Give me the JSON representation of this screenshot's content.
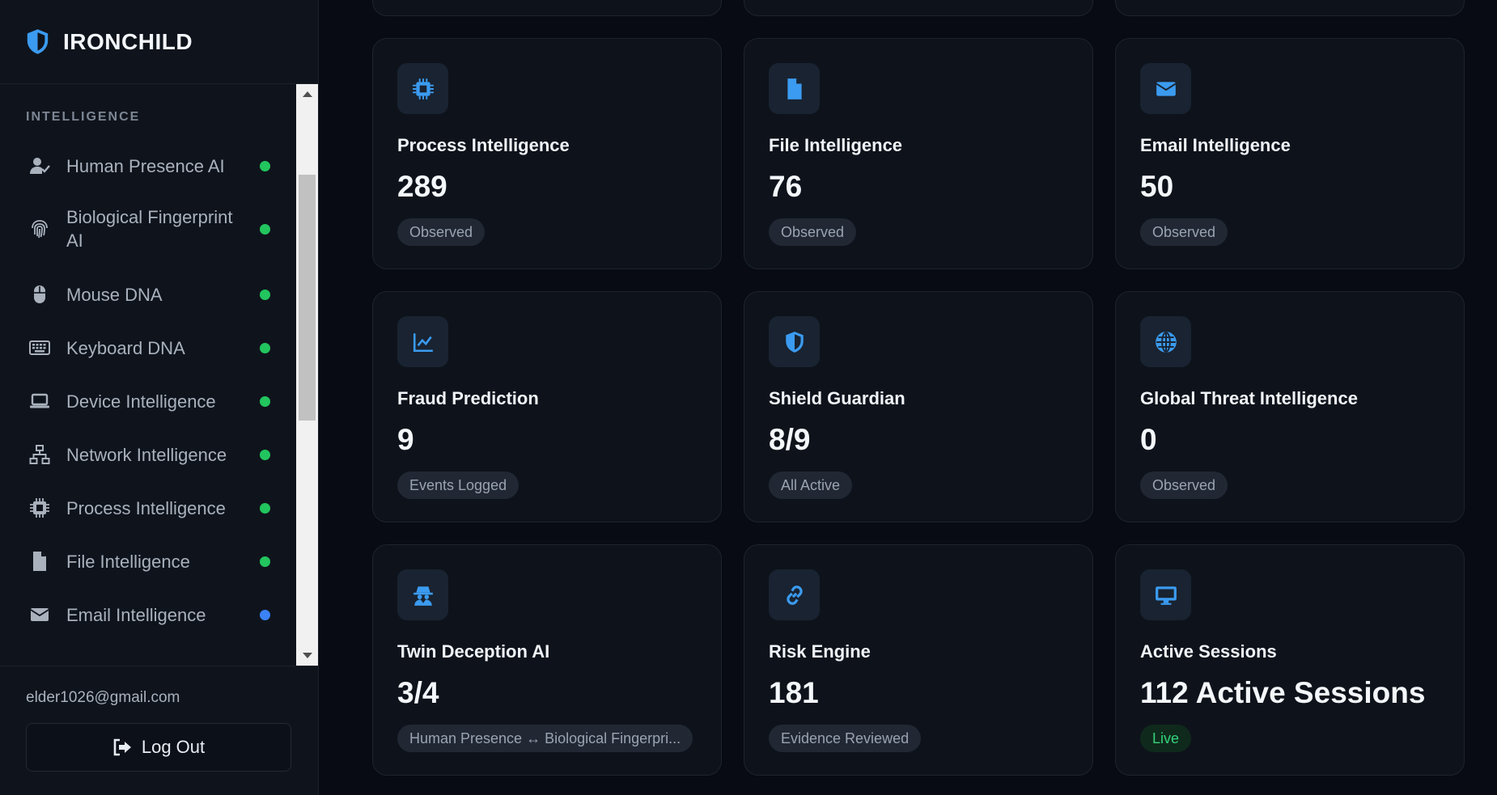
{
  "brand": {
    "name": "IRONCHILD",
    "icon": "shield-icon"
  },
  "sidebar": {
    "section_title": "INTELLIGENCE",
    "items": [
      {
        "label": "Human Presence AI",
        "icon": "user-check-icon",
        "status": "green"
      },
      {
        "label": "Biological Fingerprint AI",
        "icon": "fingerprint-icon",
        "status": "green"
      },
      {
        "label": "Mouse DNA",
        "icon": "mouse-icon",
        "status": "green"
      },
      {
        "label": "Keyboard DNA",
        "icon": "keyboard-icon",
        "status": "green"
      },
      {
        "label": "Device Intelligence",
        "icon": "laptop-icon",
        "status": "green"
      },
      {
        "label": "Network Intelligence",
        "icon": "network-icon",
        "status": "green"
      },
      {
        "label": "Process Intelligence",
        "icon": "cpu-icon",
        "status": "green"
      },
      {
        "label": "File Intelligence",
        "icon": "file-icon",
        "status": "green"
      },
      {
        "label": "Email Intelligence",
        "icon": "envelope-icon",
        "status": "blue"
      }
    ],
    "user_email": "elder1026@gmail.com",
    "logout_label": "Log Out"
  },
  "cards": [
    {
      "title": "Process Intelligence",
      "value": "289",
      "badge": "Observed",
      "icon": "cpu-icon"
    },
    {
      "title": "File Intelligence",
      "value": "76",
      "badge": "Observed",
      "icon": "file-icon"
    },
    {
      "title": "Email Intelligence",
      "value": "50",
      "badge": "Observed",
      "icon": "envelope-icon"
    },
    {
      "title": "Fraud Prediction",
      "value": "9",
      "badge": "Events Logged",
      "icon": "chart-line-icon"
    },
    {
      "title": "Shield Guardian",
      "value": "8/9",
      "badge": "All Active",
      "icon": "shield-icon"
    },
    {
      "title": "Global Threat Intelligence",
      "value": "0",
      "badge": "Observed",
      "icon": "globe-icon"
    },
    {
      "title": "Twin Deception AI",
      "value": "3/4",
      "badge": "Human Presence ↔ Biological Fingerpri...",
      "icon": "spy-icon"
    },
    {
      "title": "Risk Engine",
      "value": "181",
      "badge": "Evidence Reviewed",
      "icon": "link-icon"
    },
    {
      "title": "Active Sessions",
      "value": "112 Active Sessions",
      "badge": "Live",
      "icon": "monitor-icon"
    }
  ],
  "colors": {
    "accent": "#3b9bf0",
    "status_green": "#22c55e",
    "status_blue": "#3b82f6",
    "live_text": "#34d27a",
    "background": "#080b13",
    "card_bg": "#0e131b"
  }
}
